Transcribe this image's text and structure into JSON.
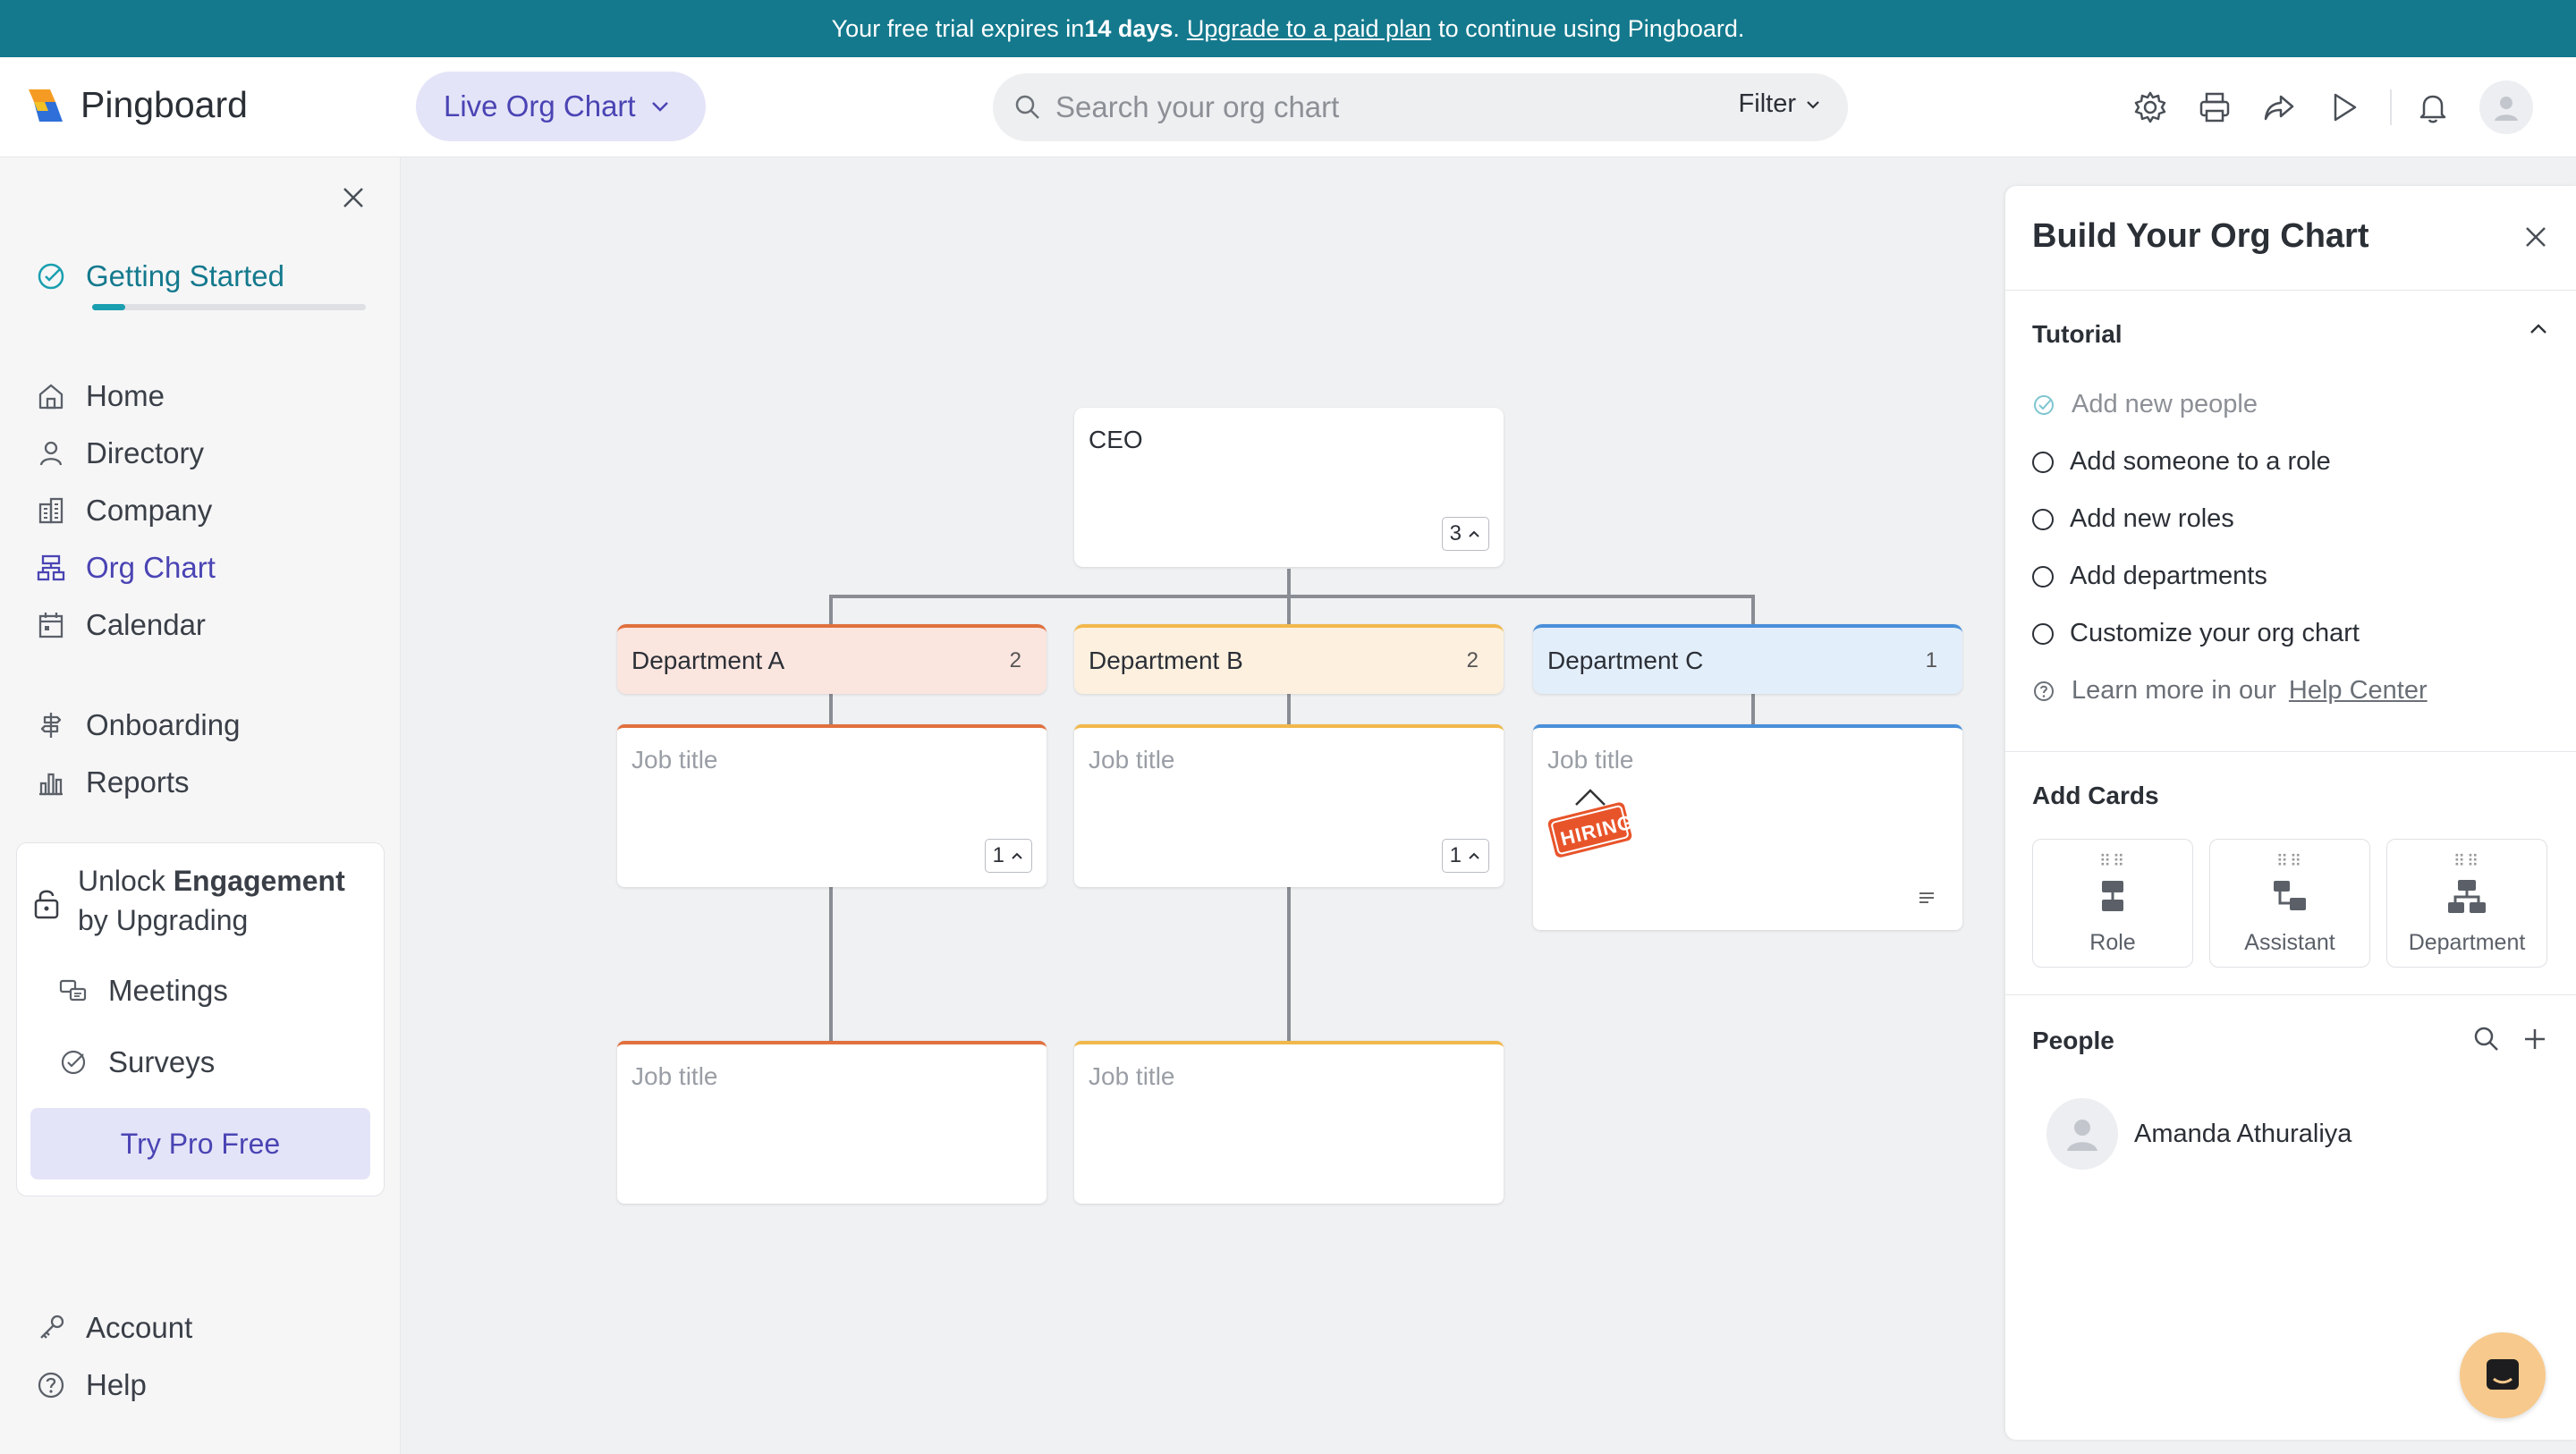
{
  "banner": {
    "prefix": "Your free trial expires in",
    "days": "14 days",
    "dot": ".",
    "link": "Upgrade to a paid plan",
    "suffix": "to continue using Pingboard."
  },
  "app": {
    "name": "Pingboard"
  },
  "header": {
    "view_selector": "Live Org Chart",
    "search_placeholder": "Search your org chart",
    "filter_label": "Filter"
  },
  "sidebar": {
    "getting_started": "Getting Started",
    "getting_started_progress": 0.12,
    "nav": [
      {
        "label": "Home",
        "icon": "home-icon"
      },
      {
        "label": "Directory",
        "icon": "person-icon"
      },
      {
        "label": "Company",
        "icon": "building-icon"
      },
      {
        "label": "Org Chart",
        "icon": "org-chart-icon",
        "active": true
      },
      {
        "label": "Calendar",
        "icon": "calendar-icon"
      },
      {
        "label": "Onboarding",
        "icon": "onboarding-icon"
      },
      {
        "label": "Reports",
        "icon": "bar-chart-icon"
      }
    ],
    "upgrade": {
      "prefix": "Unlock",
      "bold": "Engagement",
      "suffix": "by Upgrading",
      "items": [
        {
          "label": "Meetings",
          "icon": "meetings-icon"
        },
        {
          "label": "Surveys",
          "icon": "check-circle-icon"
        }
      ],
      "cta": "Try Pro Free"
    },
    "footer": [
      {
        "label": "Account",
        "icon": "key-icon"
      },
      {
        "label": "Help",
        "icon": "help-icon"
      }
    ]
  },
  "org": {
    "ceo": {
      "title": "CEO",
      "count": "3"
    },
    "departments": [
      {
        "name": "Department A",
        "count": "2",
        "color": "#e0703e",
        "bg": "#fbe5df"
      },
      {
        "name": "Department B",
        "count": "2",
        "color": "#f1b84b",
        "bg": "#fdf0df"
      },
      {
        "name": "Department C",
        "count": "1",
        "color": "#4a90d9",
        "bg": "#e3eefb"
      }
    ],
    "job_title_placeholder": "Job title",
    "job_counts": [
      "1",
      "1"
    ],
    "hiring_label": "HIRING"
  },
  "panel": {
    "title": "Build Your Org Chart",
    "tutorial": {
      "title": "Tutorial",
      "tasks": [
        {
          "label": "Add new people",
          "done": true
        },
        {
          "label": "Add someone to a role",
          "done": false
        },
        {
          "label": "Add new roles",
          "done": false
        },
        {
          "label": "Add departments",
          "done": false
        },
        {
          "label": "Customize your org chart",
          "done": false
        }
      ],
      "learn_more": "Learn more in our",
      "help_link": "Help Center"
    },
    "add_cards": {
      "title": "Add Cards",
      "cards": [
        "Role",
        "Assistant",
        "Department"
      ]
    },
    "people": {
      "title": "People",
      "list": [
        "Amanda Athuraliya"
      ]
    }
  }
}
